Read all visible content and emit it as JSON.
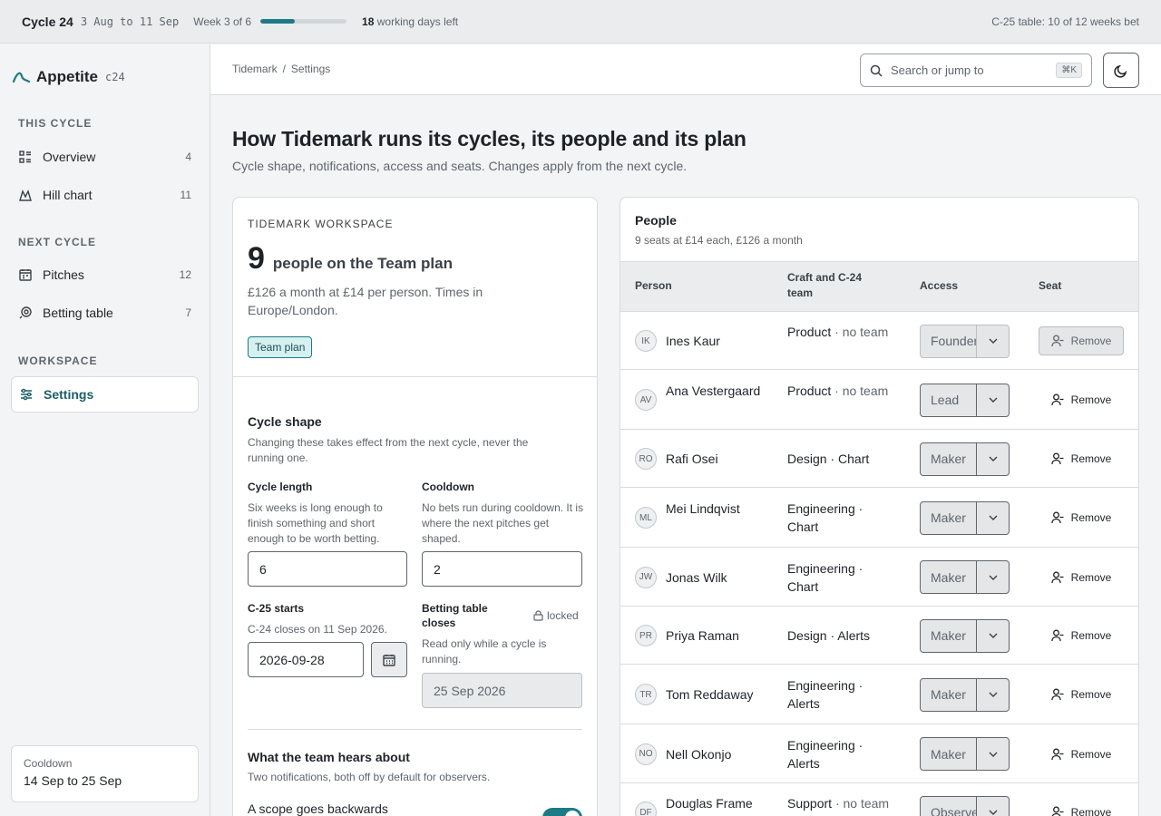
{
  "topbar": {
    "cycle": "Cycle 24",
    "dates": "3 Aug to 11 Sep",
    "week": "Week 3 of 6",
    "progress_fraction": 0.4,
    "days_count": "18",
    "days_label": "working days left",
    "table_status": "C-25 table: 10 of 12 weeks bet"
  },
  "sidebar": {
    "brand": "Appetite",
    "brand_tag": "c24",
    "this_cycle_heading": "THIS CYCLE",
    "next_cycle_heading": "NEXT CYCLE",
    "workspace_heading": "WORKSPACE",
    "items": [
      {
        "label": "Overview",
        "count": "4",
        "icon": "grid-list-icon"
      },
      {
        "label": "Hill chart",
        "count": "11",
        "icon": "hill-chart-icon"
      },
      {
        "label": "Pitches",
        "count": "12",
        "icon": "calendar-list-icon"
      },
      {
        "label": "Betting table",
        "count": "7",
        "icon": "chip-icon"
      },
      {
        "label": "Settings",
        "count": "",
        "icon": "sliders-icon"
      }
    ],
    "cooldown": {
      "title": "Cooldown",
      "value": "14 Sep to 25 Sep"
    }
  },
  "header": {
    "breadcrumb": [
      "Tidemark",
      "Settings"
    ],
    "search_placeholder": "Search or jump to",
    "search_shortcut": "⌘K"
  },
  "page": {
    "title": "How Tidemark runs its cycles, its people and its plan",
    "subtitle": "Cycle shape, notifications, access and seats. Changes apply from the next cycle."
  },
  "workspace": {
    "label": "TIDEMARK WORKSPACE",
    "count": "9",
    "count_desc": "people on the Team plan",
    "price": "£126 a month at £14 per person. Times in Europe/London.",
    "plan_badge": "Team plan"
  },
  "cycle_shape": {
    "title": "Cycle shape",
    "desc": "Changing these takes effect from the next cycle, never the running one.",
    "length_label": "Cycle length",
    "length_help": "Six weeks is long enough to finish something and short enough to be worth betting.",
    "length_value": "6",
    "cooldown_label": "Cooldown",
    "cooldown_help": "No bets run during cooldown. It is where the next pitches get shaped.",
    "cooldown_value": "2",
    "starts_label": "C-25 starts",
    "starts_help": "C-24 closes on 11 Sep 2026.",
    "starts_value": "2026-09-28",
    "closes_label": "Betting table closes",
    "closes_locked": "locked",
    "closes_help": "Read only while a cycle is running.",
    "closes_value": "25 Sep 2026"
  },
  "notifications": {
    "title": "What the team hears about",
    "desc": "Two notifications, both off by default for observers.",
    "item1": "A scope goes backwards",
    "item1_on": true
  },
  "people": {
    "title": "People",
    "subtitle": "9 seats at £14 each, £126 a month",
    "columns": [
      "Person",
      "Craft and C-24 team",
      "Access",
      "Seat"
    ],
    "remove_label": "Remove",
    "rows": [
      {
        "initials": "IK",
        "name": "Ines Kaur",
        "craft": "Product",
        "team": "no team",
        "access": "Founder",
        "locked": true
      },
      {
        "initials": "AV",
        "name": "Ana Vestergaard",
        "craft": "Product",
        "team": "no team",
        "access": "Lead",
        "locked": false
      },
      {
        "initials": "RO",
        "name": "Rafi Osei",
        "craft": "Design",
        "team": "Chart",
        "access": "Maker",
        "locked": false
      },
      {
        "initials": "ML",
        "name": "Mei Lindqvist",
        "craft": "Engineering",
        "team": "Chart",
        "access": "Maker",
        "locked": false
      },
      {
        "initials": "JW",
        "name": "Jonas Wilk",
        "craft": "Engineering",
        "team": "Chart",
        "access": "Maker",
        "locked": false
      },
      {
        "initials": "PR",
        "name": "Priya Raman",
        "craft": "Design",
        "team": "Alerts",
        "access": "Maker",
        "locked": false
      },
      {
        "initials": "TR",
        "name": "Tom Reddaway",
        "craft": "Engineering",
        "team": "Alerts",
        "access": "Maker",
        "locked": false
      },
      {
        "initials": "NO",
        "name": "Nell Okonjo",
        "craft": "Engineering",
        "team": "Alerts",
        "access": "Maker",
        "locked": false
      },
      {
        "initials": "DF",
        "name": "Douglas Frame",
        "craft": "Support",
        "team": "no team",
        "access": "Observer",
        "locked": false
      }
    ]
  },
  "colors": {
    "accent": "#1d7b84",
    "badge_bg": "#d6f0ef"
  }
}
